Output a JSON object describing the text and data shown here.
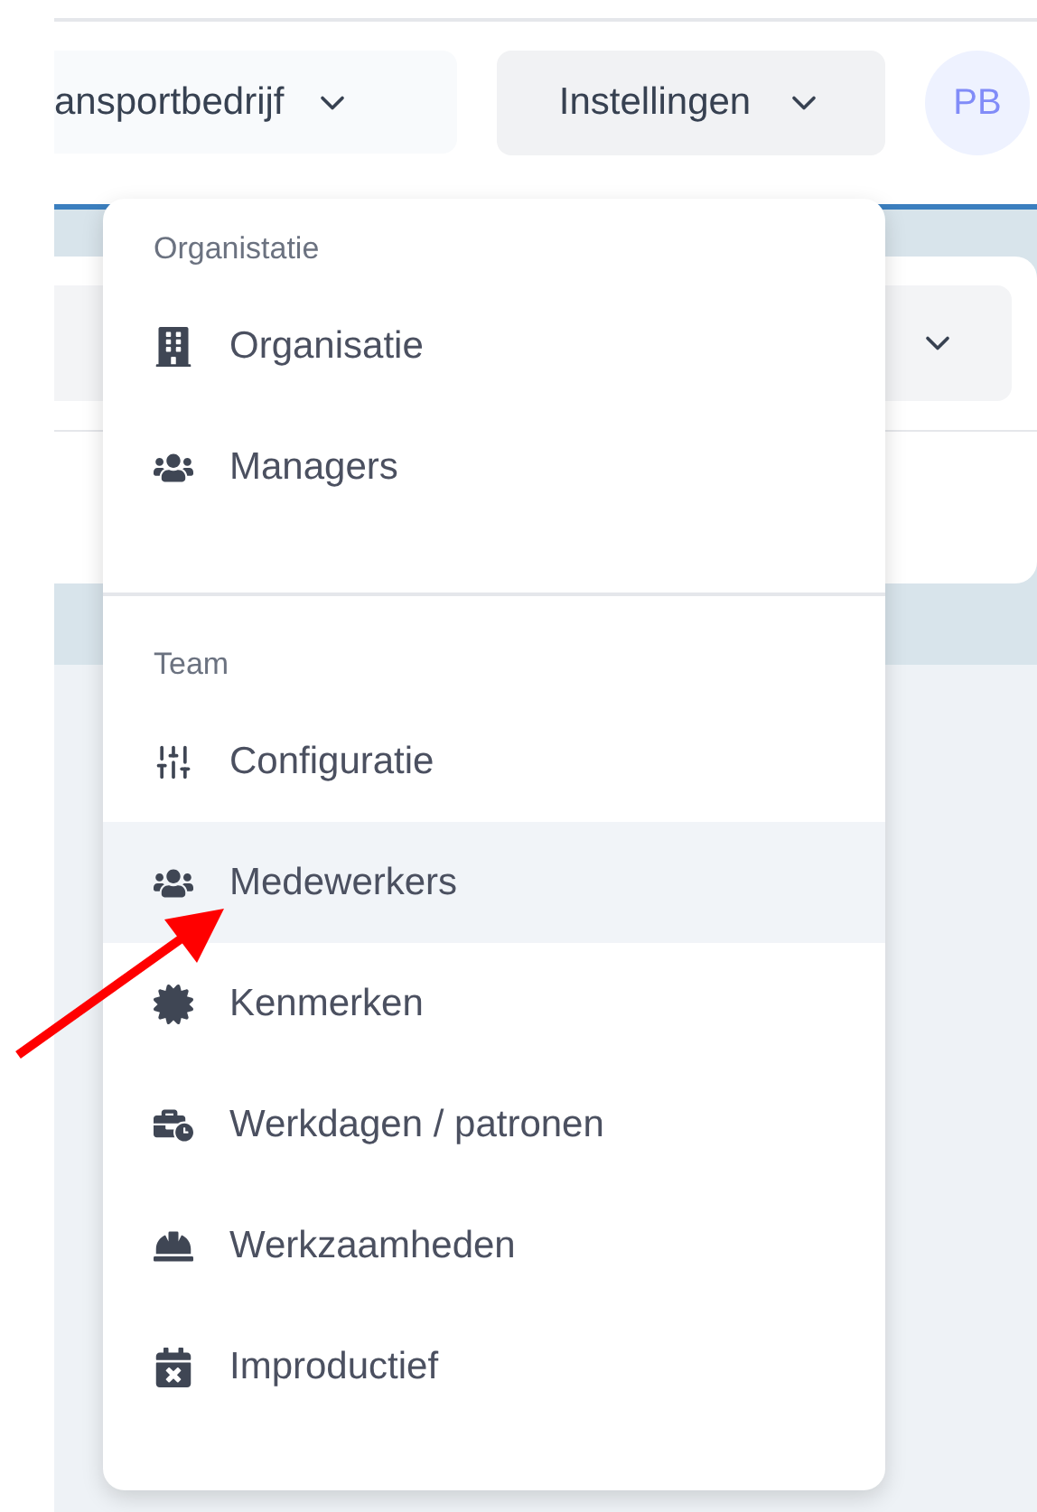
{
  "header": {
    "company_button": {
      "label": "ansportbedrijf"
    },
    "settings_button": {
      "label": "Instellingen"
    },
    "avatar": {
      "initials": "PB"
    }
  },
  "menu": {
    "sections": [
      {
        "title": "Organistatie",
        "items": [
          {
            "label": "Organisatie",
            "kind": "building",
            "selected": false
          },
          {
            "label": "Managers",
            "kind": "group",
            "selected": false
          }
        ]
      },
      {
        "title": "Team",
        "items": [
          {
            "label": "Configuratie",
            "kind": "sliders",
            "selected": false
          },
          {
            "label": "Medewerkers",
            "kind": "group",
            "selected": true
          },
          {
            "label": "Kenmerken",
            "kind": "badge",
            "selected": false
          },
          {
            "label": "Werkdagen / patronen",
            "kind": "briefcase",
            "selected": false
          },
          {
            "label": "Werkzaamheden",
            "kind": "worker",
            "selected": false
          },
          {
            "label": "Improductief",
            "kind": "calendar",
            "selected": false
          }
        ]
      }
    ]
  }
}
